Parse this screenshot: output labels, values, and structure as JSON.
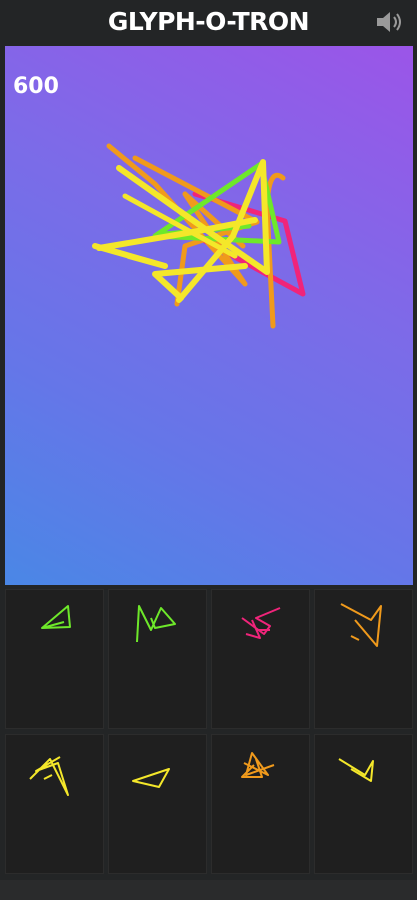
{
  "app": {
    "title": "GLYPH-O-TRON",
    "sound_icon": "speaker-icon"
  },
  "game": {
    "score": "600"
  },
  "colors": {
    "background": "#232526",
    "green": "#6ee82a",
    "yellow": "#f4e72a",
    "orange": "#f09a1c",
    "pink": "#f0247a",
    "gradient_top_right": "#9b55e8",
    "gradient_bottom_left": "#4a87e6"
  },
  "glyph_tiles": [
    {
      "name": "glyph-tile-1",
      "color": "green"
    },
    {
      "name": "glyph-tile-2",
      "color": "green"
    },
    {
      "name": "glyph-tile-3",
      "color": "pink"
    },
    {
      "name": "glyph-tile-4",
      "color": "orange"
    },
    {
      "name": "glyph-tile-5",
      "color": "yellow"
    },
    {
      "name": "glyph-tile-6",
      "color": "yellow"
    },
    {
      "name": "glyph-tile-7",
      "color": "orange"
    },
    {
      "name": "glyph-tile-8",
      "color": "yellow"
    }
  ]
}
